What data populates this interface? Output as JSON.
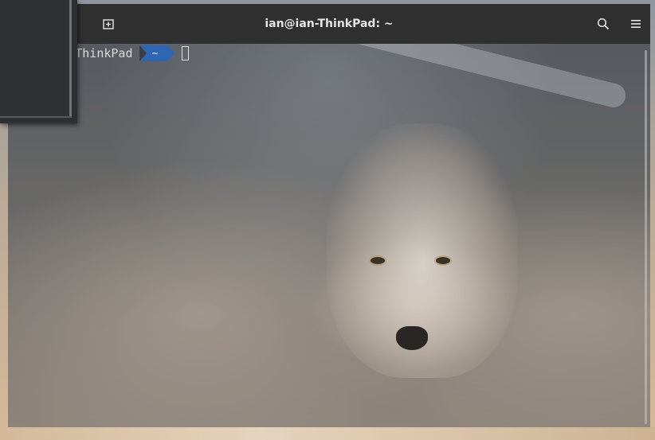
{
  "window": {
    "title": "ian@ian-ThinkPad: ~"
  },
  "headerbar": {
    "new_tab_icon": "new-tab-icon",
    "search_icon": "search-icon",
    "menu_icon": "hamburger-menu-icon"
  },
  "terminal": {
    "prompt_host": "ian@ian-ThinkPad",
    "prompt_dir": "~"
  },
  "colors": {
    "headerbar": "#303030",
    "prompt_segment": "#2e66b3",
    "terminal_bg": "#3c3e42"
  }
}
